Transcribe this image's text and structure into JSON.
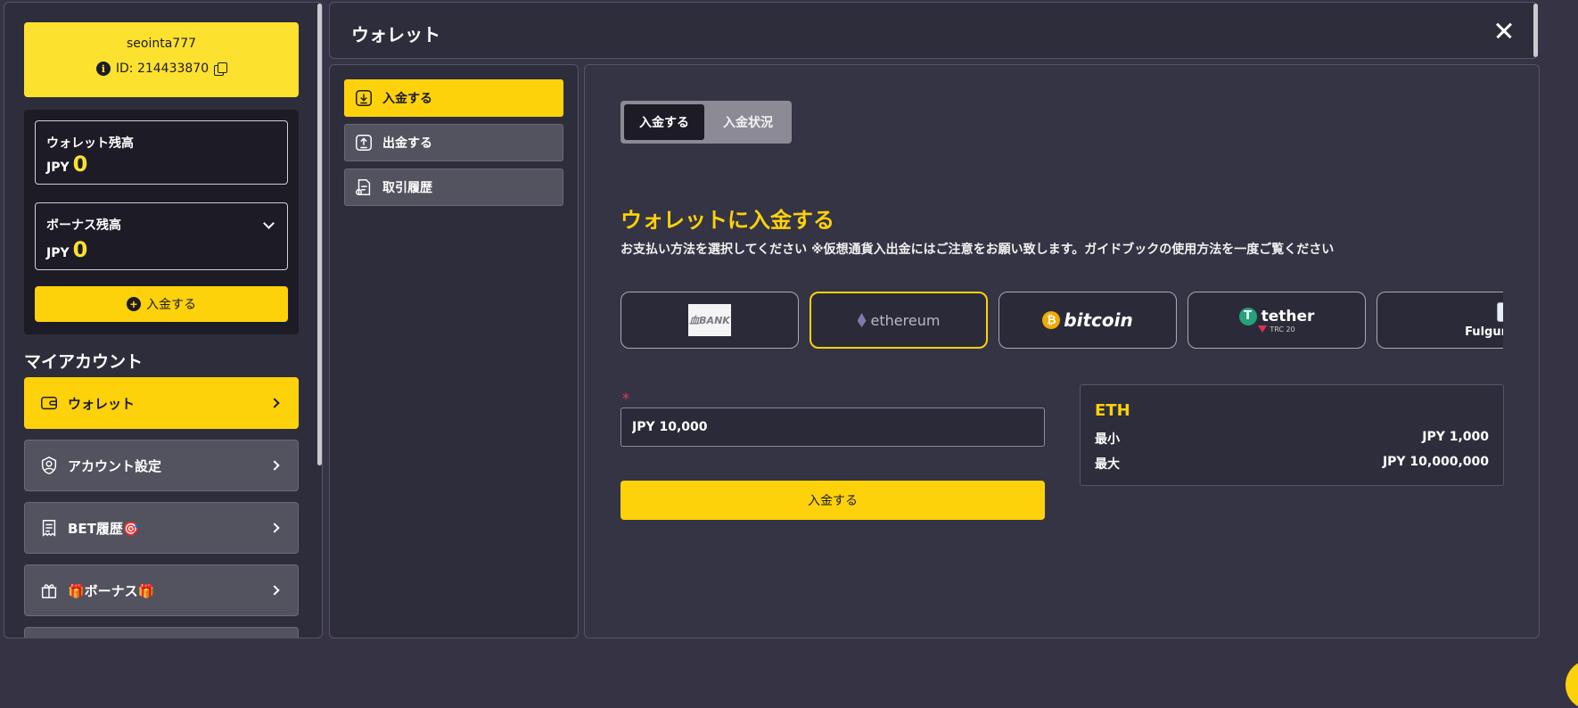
{
  "user": {
    "name": "seointa777",
    "id_label": "ID: 214433870"
  },
  "balances": {
    "wallet": {
      "label": "ウォレット残高",
      "currency": "JPY",
      "amount": "0"
    },
    "bonus": {
      "label": "ボーナス残高",
      "currency": "JPY",
      "amount": "0"
    },
    "deposit_label": "入金する"
  },
  "account": {
    "title": "マイアカウント",
    "items": [
      {
        "label": "ウォレット",
        "icon": "wallet-icon",
        "active": true
      },
      {
        "label": "アカウント設定",
        "icon": "user-shield-icon",
        "active": false
      },
      {
        "label": "BET履歴🎯",
        "icon": "receipt-icon",
        "active": false
      },
      {
        "label": "🎁ボーナス🎁",
        "icon": "gift-box-icon",
        "active": false
      }
    ]
  },
  "header": {
    "title": "ウォレット"
  },
  "subnav": {
    "items": [
      {
        "label": "入金する",
        "icon": "download-icon",
        "active": true
      },
      {
        "label": "出金する",
        "icon": "upload-icon",
        "active": false
      },
      {
        "label": "取引履歴",
        "icon": "document-icon",
        "active": false
      }
    ]
  },
  "tabs": {
    "deposit": "入金する",
    "status": "入金状況"
  },
  "content": {
    "heading": "ウォレットに入金する",
    "subheading": "お支払い方法を選択してください ※仮想通貨入出金にはご注意をお願い致します。ガイドブックの使用方法を一度ご覧ください"
  },
  "methods": {
    "bank": "血BANK",
    "ethereum": "ethereum",
    "bitcoin": "bitcoin",
    "tether": "tether",
    "tether_sub": "TRC 20",
    "fulgur": "FulgurPayTRX",
    "selected": "ethereum"
  },
  "form": {
    "required_mark": "*",
    "amount_value": "JPY 10,000",
    "submit_label": "入金する"
  },
  "limits": {
    "coin": "ETH",
    "min_label": "最小",
    "min_value": "JPY 1,000",
    "max_label": "最大",
    "max_value": "JPY 10,000,000"
  },
  "colors": {
    "accent": "#fdd20a",
    "panel": "#2e2d3b",
    "background": "#363444"
  }
}
